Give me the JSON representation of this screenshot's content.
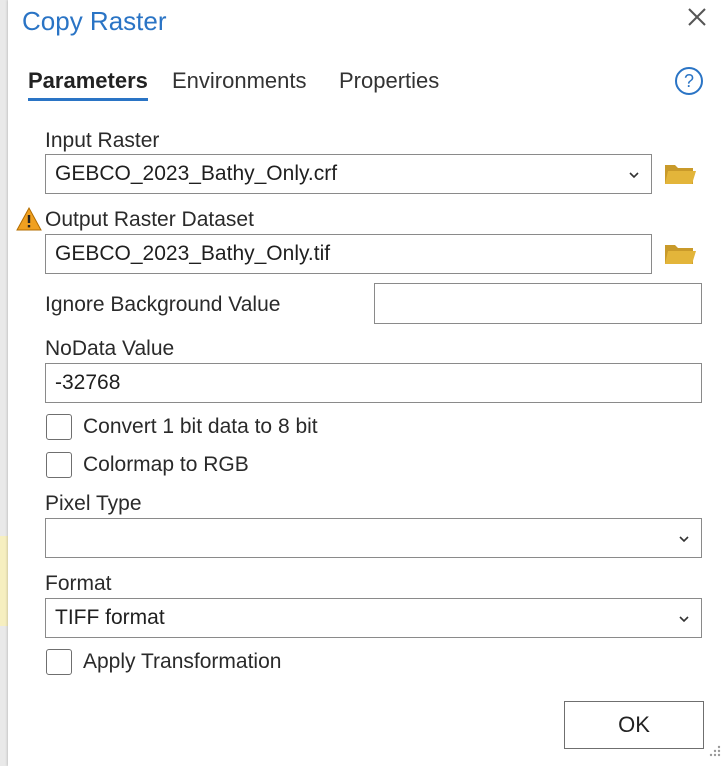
{
  "dialog": {
    "title": "Copy Raster",
    "close_icon": "close-icon",
    "help_icon": "help-icon",
    "tabs": [
      {
        "label": "Parameters",
        "active": true
      },
      {
        "label": "Environments",
        "active": false
      },
      {
        "label": "Properties",
        "active": false
      }
    ]
  },
  "params": {
    "input_raster": {
      "label": "Input Raster",
      "value": "GEBCO_2023_Bathy_Only.crf"
    },
    "output_raster": {
      "label": "Output Raster Dataset",
      "value": "GEBCO_2023_Bathy_Only.tif",
      "warning": true
    },
    "ignore_background": {
      "label": "Ignore Background Value",
      "value": ""
    },
    "nodata": {
      "label": "NoData Value",
      "value": "-32768"
    },
    "convert_bit": {
      "label": "Convert 1 bit data to 8 bit",
      "checked": false
    },
    "colormap_rgb": {
      "label": "Colormap to RGB",
      "checked": false
    },
    "pixel_type": {
      "label": "Pixel Type",
      "value": ""
    },
    "format": {
      "label": "Format",
      "value": "TIFF format"
    },
    "apply_transformation": {
      "label": "Apply Transformation",
      "checked": false
    }
  },
  "footer": {
    "ok_label": "OK"
  },
  "colors": {
    "accent": "#2a74c5",
    "folder": "#e3b53a",
    "warning": "#f0a020"
  }
}
